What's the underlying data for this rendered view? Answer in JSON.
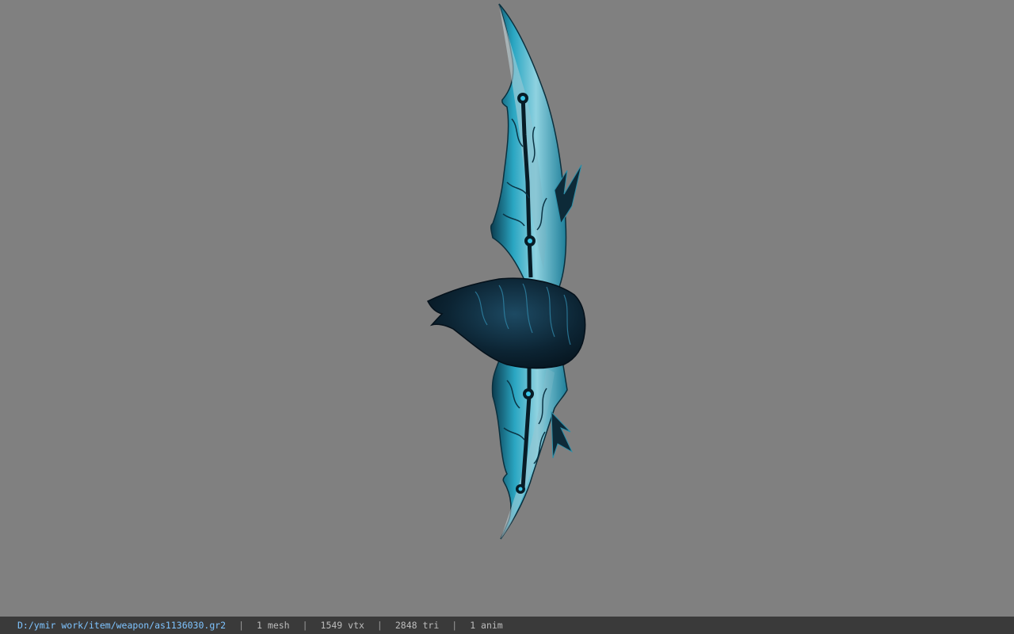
{
  "viewer": {
    "background_color": "#808080",
    "model_description_icon": "curved-twin-blade-weapon"
  },
  "status_bar": {
    "file_path": "D:/ymir work/item/weapon/as1136030.gr2",
    "separator": "|",
    "mesh_count": "1 mesh",
    "vertex_count": "1549 vtx",
    "triangle_count": "2848 tri",
    "anim_count": "1 anim",
    "path_color": "#7fc4ff"
  }
}
